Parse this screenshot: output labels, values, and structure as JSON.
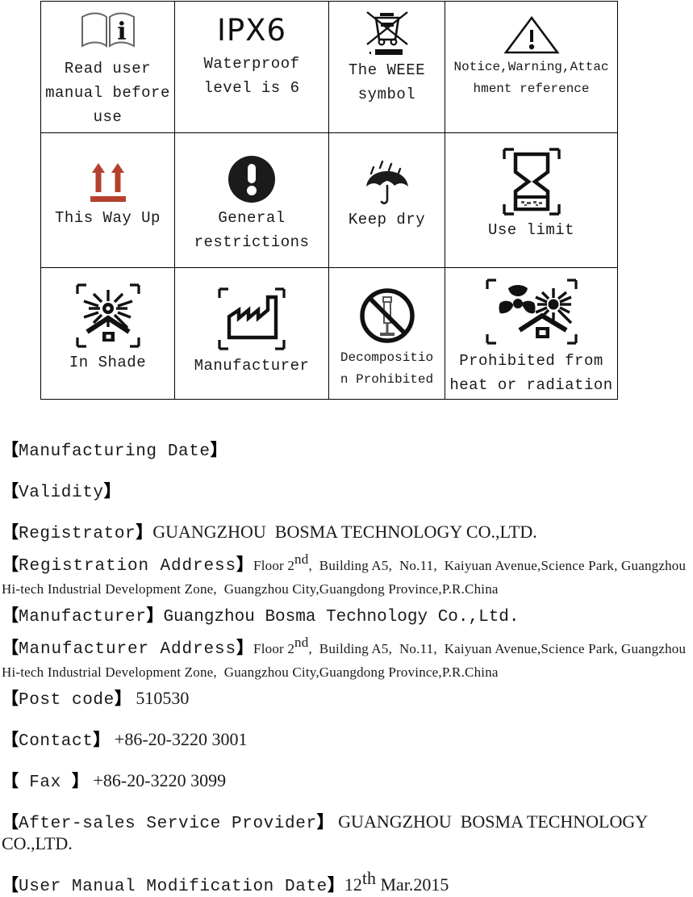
{
  "symbol_table": {
    "rows": [
      [
        {
          "icon": "read-user-manual-icon",
          "caption": "Read user\nmanual before\nuse"
        },
        {
          "icon": "ipx6-text-icon",
          "icon_text": "IPX6",
          "caption": "Waterproof\nlevel is 6"
        },
        {
          "icon": "weee-crossed-bin-icon",
          "caption": "The WEEE\nsymbol"
        },
        {
          "icon": "warning-triangle-icon",
          "caption": "Notice,Warning,Attac\nhment reference",
          "small": true
        }
      ],
      [
        {
          "icon": "this-way-up-icon",
          "caption": "This Way Up"
        },
        {
          "icon": "general-restrictions-icon",
          "caption": "General\nrestrictions"
        },
        {
          "icon": "keep-dry-umbrella-icon",
          "caption": "Keep dry"
        },
        {
          "icon": "use-limit-hourglass-icon",
          "caption": "Use limit"
        }
      ],
      [
        {
          "icon": "in-shade-icon",
          "caption": "In Shade"
        },
        {
          "icon": "manufacturer-factory-icon",
          "caption": "Manufacturer"
        },
        {
          "icon": "decomposition-prohibited-icon",
          "caption": "Decompositio\nn Prohibited",
          "small": true
        },
        {
          "icon": "prohibited-heat-radiation-icon",
          "caption": "Prohibited from\nheat or radiation"
        }
      ]
    ]
  },
  "info": {
    "manufacturing_date": {
      "label": "Manufacturing Date",
      "value": ""
    },
    "validity": {
      "label": "Validity",
      "value": ""
    },
    "registrator": {
      "label": "Registrator",
      "value": "GUANGZHOU  BOSMA TECHNOLOGY CO.,LTD."
    },
    "registration_address": {
      "label": "Registration Address",
      "value_p1": "Floor 2",
      "value_sup": "nd",
      "value_p2": ",  Building A5,  No.11,  Kaiyuan Avenue,Science Park, Guangzhou Hi-tech Industrial Development Zone,  Guangzhou City,Guangdong Province,P.R.China"
    },
    "manufacturer": {
      "label": "Manufacturer",
      "value": "Guangzhou Bosma Technology Co.,Ltd."
    },
    "manufacturer_address": {
      "label": "Manufacturer Address",
      "value_p1": "Floor 2",
      "value_sup": "nd",
      "value_p2": ",  Building A5,  No.11,  Kaiyuan Avenue,Science Park, Guangzhou Hi-tech Industrial Development Zone,  Guangzhou City,Guangdong Province,P.R.China"
    },
    "post_code": {
      "label": "Post code",
      "value": " 510530"
    },
    "contact": {
      "label": "Contact",
      "value": " +86-20-3220 3001"
    },
    "fax": {
      "label": " Fax ",
      "value": " +86-20-3220 3099"
    },
    "after_sales": {
      "label": "After-sales Service Provider",
      "value": " GUANGZHOU  BOSMA TECHNOLOGY CO.,LTD."
    },
    "manual_modification_date": {
      "label": "User Manual Modification Date",
      "value_p1": "12",
      "value_sup": "th",
      "value_p2": " Mar.2015"
    }
  },
  "brackets": {
    "open": "【",
    "close": "】"
  },
  "colors": {
    "arrow_red": "#b5402e",
    "ink": "#1a1a1a",
    "border": "#000000"
  }
}
